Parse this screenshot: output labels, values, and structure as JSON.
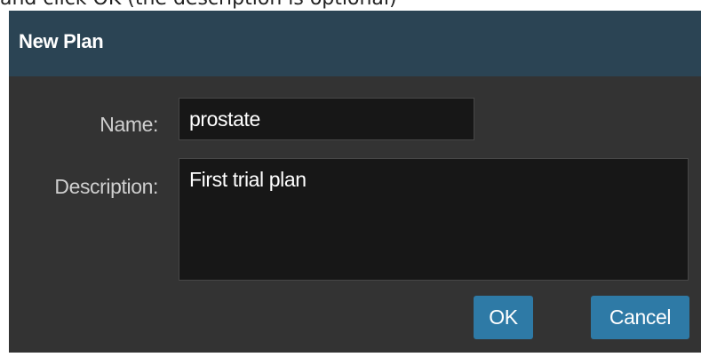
{
  "caption": "and click OK (the description is optional)",
  "dialog": {
    "title": "New Plan",
    "name_label": "Name:",
    "name_value": "prostate",
    "description_label": "Description:",
    "description_value": "First trial plan",
    "ok_label": "OK",
    "cancel_label": "Cancel"
  },
  "colors": {
    "titlebar": "#2b4454",
    "body": "#333333",
    "input_bg": "#171717",
    "button": "#2e7aa6"
  }
}
